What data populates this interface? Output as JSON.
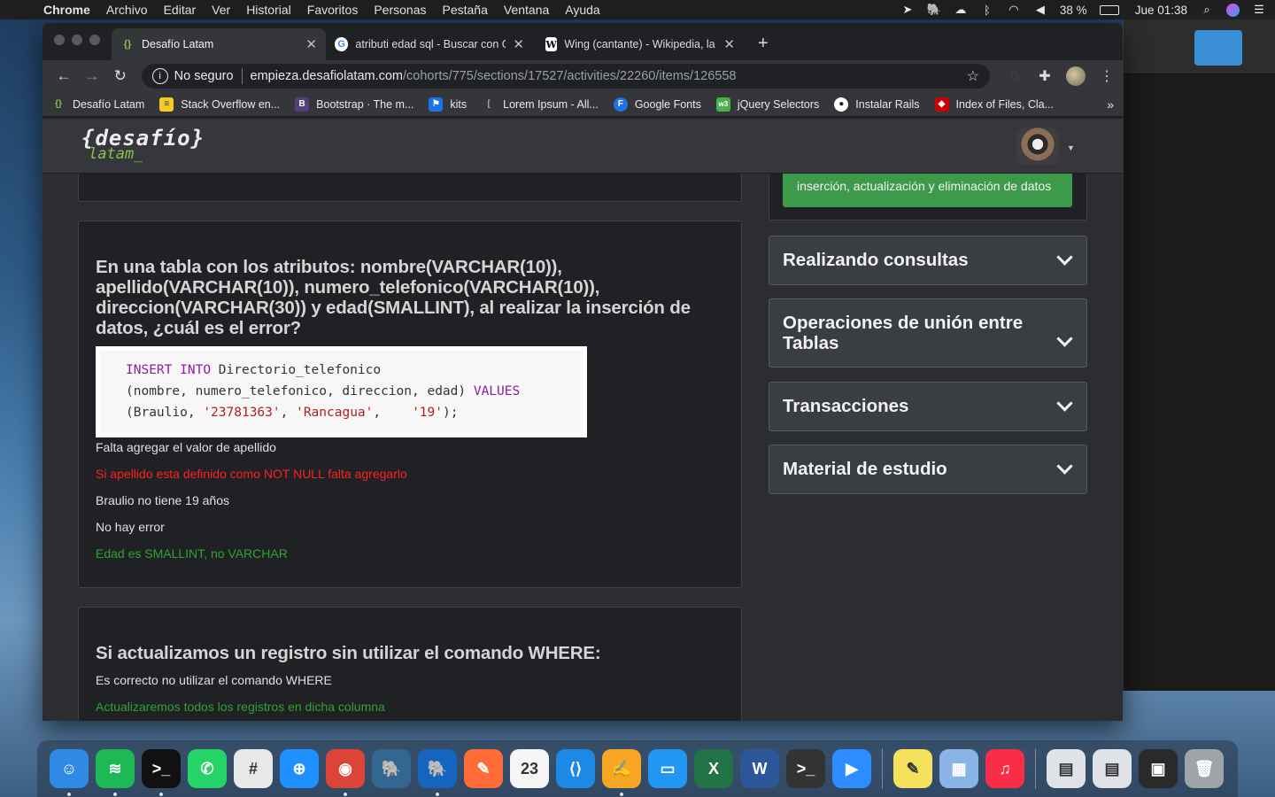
{
  "menubar": {
    "app": "Chrome",
    "items": [
      "Archivo",
      "Editar",
      "Ver",
      "Historial",
      "Favoritos",
      "Personas",
      "Pestaña",
      "Ventana",
      "Ayuda"
    ],
    "battery": "38 %",
    "clock": "Jue 01:38"
  },
  "tabs": [
    {
      "title": "Desafío Latam",
      "icon": "desafio-icon"
    },
    {
      "title": "atributi edad sql - Buscar con Google",
      "icon": "google-icon"
    },
    {
      "title": "Wing (cantante) - Wikipedia, la enciclopedia libre",
      "icon": "wikipedia-icon"
    }
  ],
  "omnibox": {
    "security": "No seguro",
    "host": "empieza.desafiolatam.com",
    "path": "/cohorts/775/sections/17527/activities/22260/items/126558"
  },
  "bookmarks": [
    {
      "label": "Desafío Latam",
      "icon": "desafio-icon",
      "color": "#89c34a"
    },
    {
      "label": "Stack Overflow en...",
      "icon": "stackoverflow-icon",
      "color": "#f48024"
    },
    {
      "label": "Bootstrap · The m...",
      "icon": "bootstrap-icon",
      "color": "#563d7c"
    },
    {
      "label": "kits",
      "icon": "flag-icon",
      "color": "#1a73e8"
    },
    {
      "label": "Lorem Ipsum - All...",
      "icon": "lorem-icon",
      "color": "#888888"
    },
    {
      "label": "Google Fonts",
      "icon": "google-fonts-icon",
      "color": "#1a73e8"
    },
    {
      "label": "jQuery Selectors",
      "icon": "w3-icon",
      "color": "#4caf50"
    },
    {
      "label": "Instalar Rails",
      "icon": "github-icon",
      "color": "#ffffff"
    },
    {
      "label": "Index of Files, Cla...",
      "icon": "ruby-icon",
      "color": "#cc0000"
    }
  ],
  "site": {
    "logo_top": "{desafío}",
    "logo_bottom": "latam_"
  },
  "question1": {
    "title": "En una tabla con los atributos: nombre(VARCHAR(10)), apellido(VARCHAR(10)), numero_telefonico(VARCHAR(10)), direccion(VARCHAR(30)) y edad(SMALLINT), al realizar la inserción de datos, ¿cuál es el error?",
    "code": {
      "kw_insert": "INSERT",
      "kw_into": "INTO",
      "table": "Directorio_telefonico",
      "columns": "(nombre, numero_telefonico, direccion, edad)",
      "kw_values": "VALUES",
      "open": "(Braulio, ",
      "v1": "'23781363'",
      "comma1": ", ",
      "v2": "'Rancagua'",
      "comma2": ",    ",
      "v3": "'19'",
      "close": ");"
    },
    "options": [
      {
        "text": "Falta agregar el valor de apellido",
        "state": "neutral"
      },
      {
        "text": "Si apellido esta definido como NOT NULL falta agregarlo",
        "state": "wrong"
      },
      {
        "text": "Braulio no tiene 19 años",
        "state": "neutral"
      },
      {
        "text": "No hay error",
        "state": "neutral"
      },
      {
        "text": "Edad es SMALLINT, no VARCHAR",
        "state": "correct"
      }
    ]
  },
  "question2": {
    "title": "Si actualizamos un registro sin utilizar el comando WHERE:",
    "options": [
      {
        "text": "Es correcto no utilizar el comando WHERE",
        "state": "neutral"
      },
      {
        "text": "Actualizaremos todos los registros en dicha columna",
        "state": "correct"
      }
    ]
  },
  "sidebar": {
    "green_button": "inserción, actualización y eliminación de datos",
    "sections": [
      {
        "label": "Realizando consultas"
      },
      {
        "label": "Operaciones de unión entre Tablas"
      },
      {
        "label": "Transacciones"
      },
      {
        "label": "Material de estudio"
      }
    ]
  },
  "dock": [
    {
      "name": "finder",
      "glyph": "☺",
      "color": "#2f8ae5",
      "running": true
    },
    {
      "name": "spotify",
      "glyph": "≋",
      "color": "#1db954",
      "running": true
    },
    {
      "name": "terminal",
      "glyph": ">_",
      "color": "#111111",
      "running": true
    },
    {
      "name": "whatsapp",
      "glyph": "✆",
      "color": "#25d366",
      "running": false
    },
    {
      "name": "slack",
      "glyph": "#",
      "color": "#e8e8e8",
      "running": false
    },
    {
      "name": "safari",
      "glyph": "⊕",
      "color": "#1e90ff",
      "running": false
    },
    {
      "name": "chrome",
      "glyph": "◉",
      "color": "#db4437",
      "running": true
    },
    {
      "name": "postgres",
      "glyph": "🐘",
      "color": "#336791",
      "running": false
    },
    {
      "name": "tableplus",
      "glyph": "🐘",
      "color": "#1565c0",
      "running": true
    },
    {
      "name": "postman",
      "glyph": "✎",
      "color": "#ff6c37",
      "running": false
    },
    {
      "name": "calendar",
      "glyph": "23",
      "color": "#f5f5f5",
      "running": false
    },
    {
      "name": "vscode",
      "glyph": "⟨⟩",
      "color": "#1e88e5",
      "running": false
    },
    {
      "name": "pages",
      "glyph": "✍",
      "color": "#f6a623",
      "running": true
    },
    {
      "name": "keynote",
      "glyph": "▭",
      "color": "#2196f3",
      "running": false
    },
    {
      "name": "excel",
      "glyph": "X",
      "color": "#217346",
      "running": false
    },
    {
      "name": "word",
      "glyph": "W",
      "color": "#2b579a",
      "running": false
    },
    {
      "name": "terminal2",
      "glyph": ">_",
      "color": "#333333",
      "running": false
    },
    {
      "name": "zoom",
      "glyph": "▶",
      "color": "#2d8cff",
      "running": false
    },
    {
      "name": "stickies",
      "glyph": "✎",
      "color": "#f5e15c",
      "running": false
    },
    {
      "name": "preview",
      "glyph": "▦",
      "color": "#8ab4e8",
      "running": false
    },
    {
      "name": "music",
      "glyph": "♫",
      "color": "#fa2d48",
      "running": false
    },
    {
      "name": "doc1",
      "glyph": "▤",
      "color": "#dfe3e8",
      "running": false
    },
    {
      "name": "doc2",
      "glyph": "▤",
      "color": "#dfe3e8",
      "running": false
    },
    {
      "name": "doc3",
      "glyph": "▣",
      "color": "#2a2a2a",
      "running": false
    },
    {
      "name": "trash",
      "glyph": "🗑",
      "color": "#9ea4aa",
      "running": false
    }
  ]
}
